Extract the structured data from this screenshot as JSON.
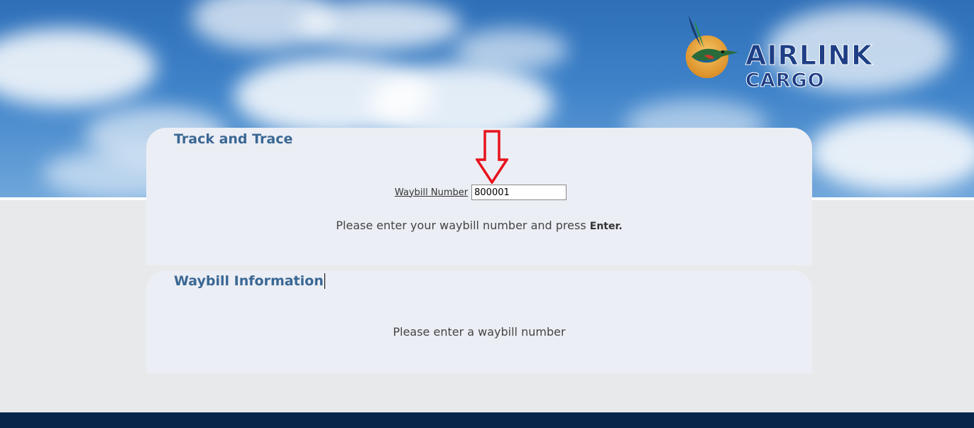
{
  "brand": {
    "line1": "AIRLINK",
    "line2": "CARGO",
    "logo_icon": "kingfisher-bird-sun-icon",
    "brand_color": "#1e3f85"
  },
  "track_panel": {
    "title": "Track and Trace",
    "waybill_label": "Waybill Number",
    "waybill_value": "800001",
    "instruction_prefix": "Please enter your waybill number and press ",
    "instruction_key": "Enter."
  },
  "info_panel": {
    "title": "Waybill Information",
    "message": "Please enter a waybill number"
  },
  "annotation": {
    "icon": "red-down-arrow-icon",
    "color": "#e8121c"
  },
  "colors": {
    "title": "#3a6794",
    "panel_bg": "#ebeef4",
    "footer": "#07264a"
  }
}
